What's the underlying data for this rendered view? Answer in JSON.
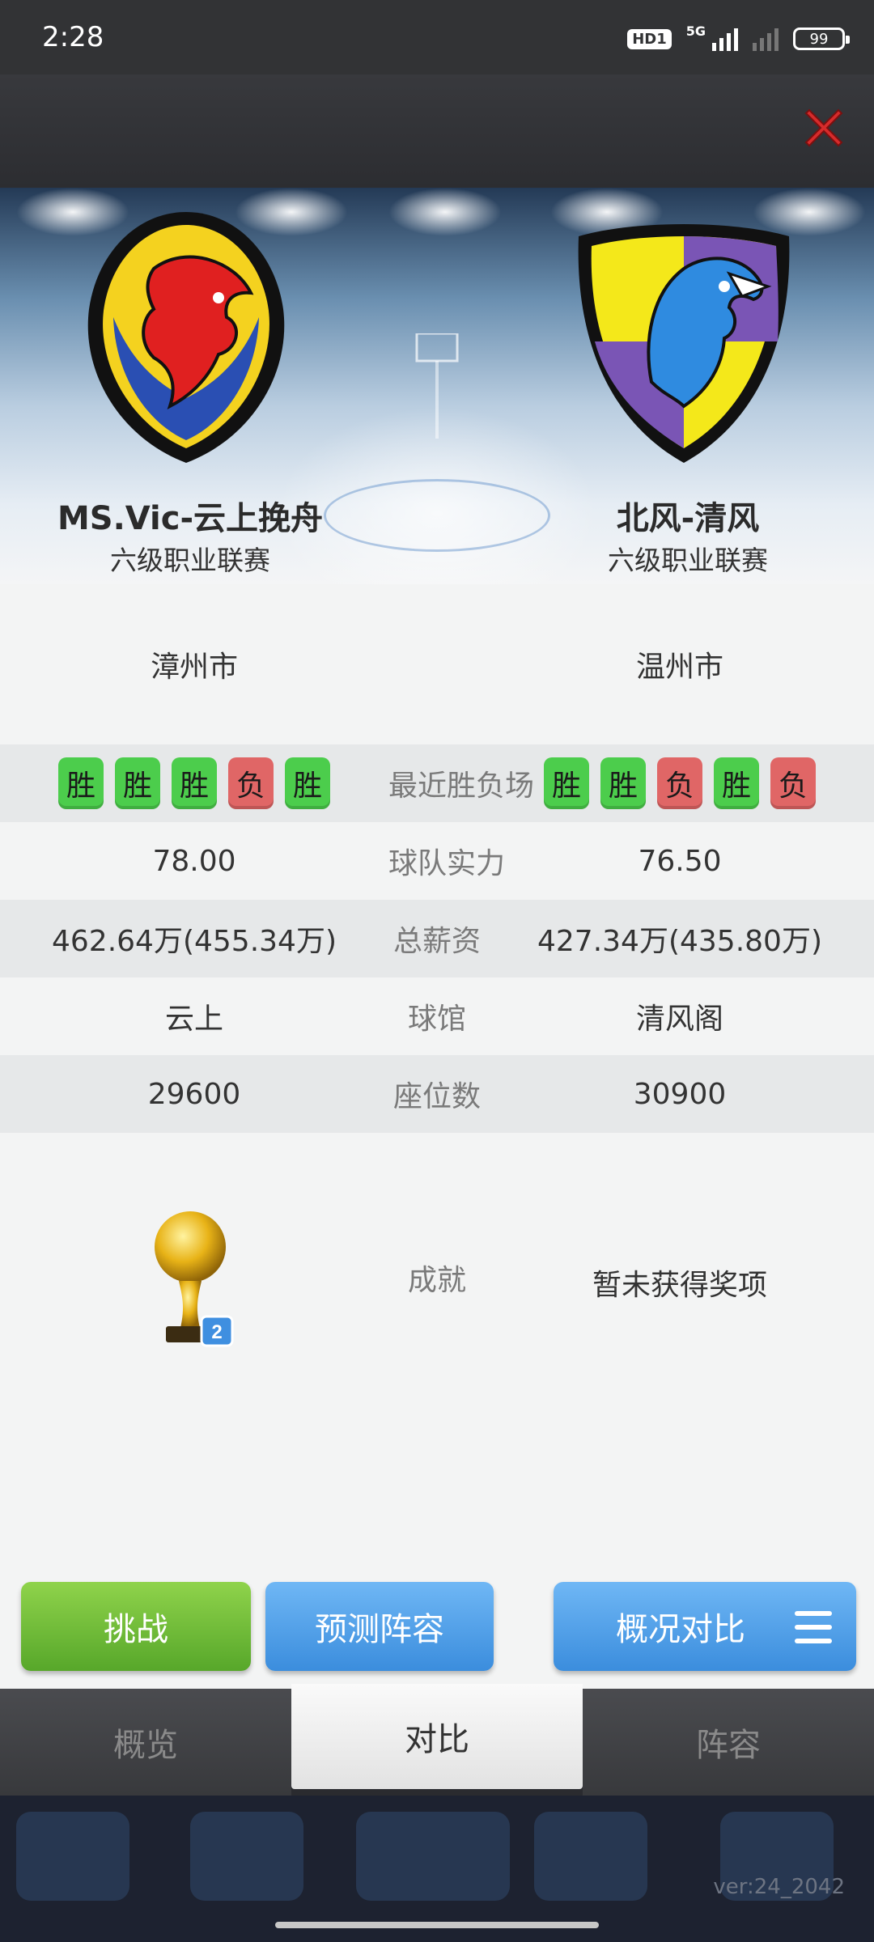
{
  "status": {
    "time": "2:28",
    "hd": "HD1",
    "network": "5G",
    "battery": "99"
  },
  "home": {
    "name": "MS.Vic-云上挽舟",
    "league": "六级职业联赛",
    "city": "漳州市",
    "form": [
      "胜",
      "胜",
      "胜",
      "负",
      "胜"
    ],
    "strength": "78.00",
    "salary": "462.64万(455.34万)",
    "arena": "云上",
    "seats": "29600",
    "achievement_badge": "2"
  },
  "away": {
    "name": "北风-清风",
    "league": "六级职业联赛",
    "city": "温州市",
    "form": [
      "胜",
      "胜",
      "负",
      "胜",
      "负"
    ],
    "strength": "76.50",
    "salary": "427.34万(435.80万)",
    "arena": "清风阁",
    "seats": "30900",
    "achievement": "暂未获得奖项"
  },
  "labels": {
    "form": "最近胜负场",
    "strength": "球队实力",
    "salary": "总薪资",
    "arena": "球馆",
    "seats": "座位数",
    "achievement": "成就"
  },
  "actions": {
    "challenge": "挑战",
    "predict": "预测阵容",
    "compare": "概况对比"
  },
  "tabs": [
    {
      "label": "概览"
    },
    {
      "label": "对比"
    },
    {
      "label": "阵容"
    }
  ],
  "footer": {
    "version": "ver:24_2042"
  },
  "colors": {
    "win": "#4ccd4c",
    "loss": "#e06666",
    "green_btn": "#6cbc36",
    "blue_btn": "#4a9be6"
  }
}
